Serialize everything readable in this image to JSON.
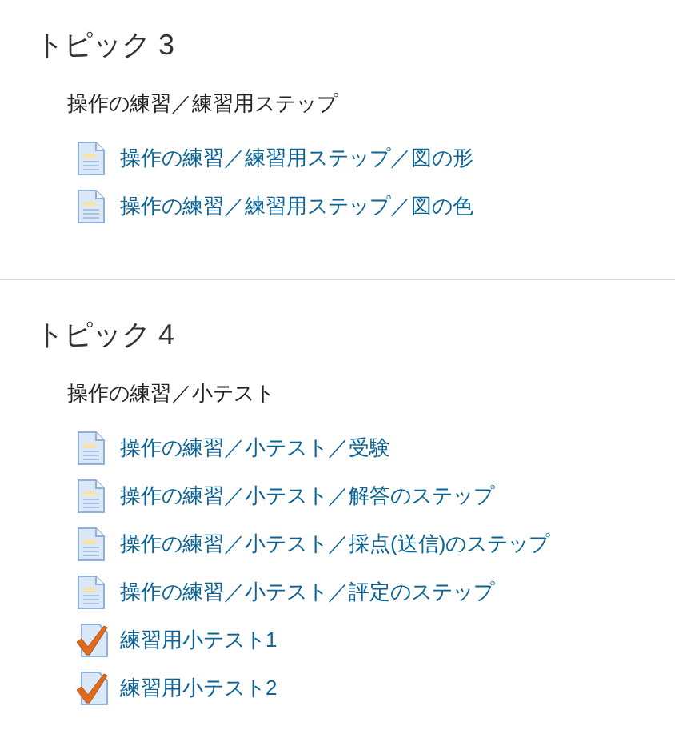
{
  "sections": [
    {
      "title": "トピック 3",
      "summary": "操作の練習／練習用ステップ",
      "activities": [
        {
          "kind": "page",
          "label": "操作の練習／練習用ステップ／図の形"
        },
        {
          "kind": "page",
          "label": "操作の練習／練習用ステップ／図の色"
        }
      ]
    },
    {
      "title": "トピック 4",
      "summary": "操作の練習／小テスト",
      "activities": [
        {
          "kind": "page",
          "label": "操作の練習／小テスト／受験"
        },
        {
          "kind": "page",
          "label": "操作の練習／小テスト／解答のステップ"
        },
        {
          "kind": "page",
          "label": "操作の練習／小テスト／採点(送信)のステップ"
        },
        {
          "kind": "page",
          "label": "操作の練習／小テスト／評定のステップ"
        },
        {
          "kind": "quiz",
          "label": "練習用小テスト1"
        },
        {
          "kind": "quiz",
          "label": "練習用小テスト2"
        }
      ]
    }
  ]
}
